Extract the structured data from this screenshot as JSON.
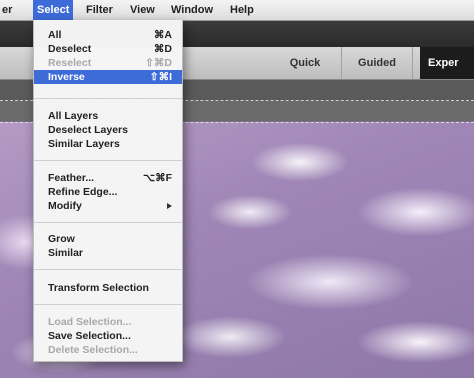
{
  "menubar": {
    "items": [
      "er",
      "Select",
      "Filter",
      "View",
      "Window",
      "Help"
    ]
  },
  "modes": {
    "quick": "Quick",
    "guided": "Guided",
    "expert": "Exper"
  },
  "select_menu": {
    "group1": [
      {
        "label": "All",
        "shortcut": "⌘A",
        "enabled": true
      },
      {
        "label": "Deselect",
        "shortcut": "⌘D",
        "enabled": true
      },
      {
        "label": "Reselect",
        "shortcut": "⇧⌘D",
        "enabled": false
      },
      {
        "label": "Inverse",
        "shortcut": "⇧⌘I",
        "enabled": true,
        "highlighted": true
      }
    ],
    "group2": [
      {
        "label": "All Layers"
      },
      {
        "label": "Deselect Layers"
      },
      {
        "label": "Similar Layers"
      }
    ],
    "group3": [
      {
        "label": "Feather...",
        "shortcut": "⌥⌘F"
      },
      {
        "label": "Refine Edge..."
      },
      {
        "label": "Modify",
        "submenu": true
      }
    ],
    "group4": [
      {
        "label": "Grow"
      },
      {
        "label": "Similar"
      }
    ],
    "group5": [
      {
        "label": "Transform Selection"
      }
    ],
    "group6": [
      {
        "label": "Load Selection...",
        "enabled": false
      },
      {
        "label": "Save Selection...",
        "enabled": true
      },
      {
        "label": "Delete Selection...",
        "enabled": false
      }
    ]
  },
  "colors": {
    "highlight": "#3d6bd8",
    "expert_tab": "#1c1c1c"
  }
}
